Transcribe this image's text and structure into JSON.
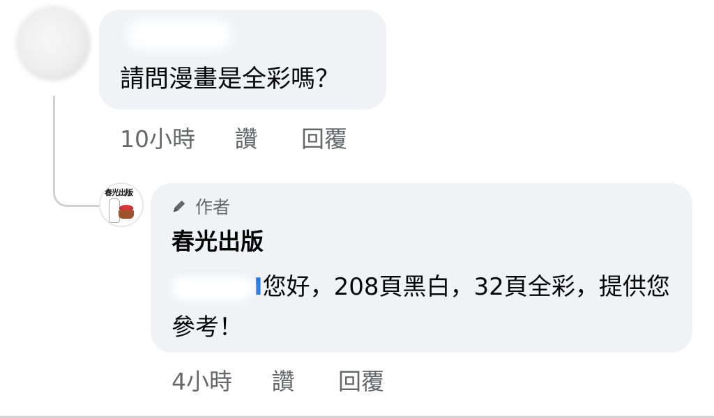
{
  "comment1": {
    "text": "請問漫畫是全彩嗎？",
    "time": "10小時",
    "like": "讚",
    "reply": "回覆"
  },
  "reply": {
    "badge_icon": "pencil-icon",
    "badge": "作者",
    "page_name": "春光出版",
    "avatar_text": "春光出版",
    "mention_tail": "I",
    "text": "您好，208頁黑白，32頁全彩，提供您參考！",
    "time": "4小時",
    "like": "讚",
    "reply": "回覆"
  },
  "colors": {
    "bubble": "#f0f2f5",
    "secondary_text": "#65676b",
    "primary_text": "#050505"
  }
}
